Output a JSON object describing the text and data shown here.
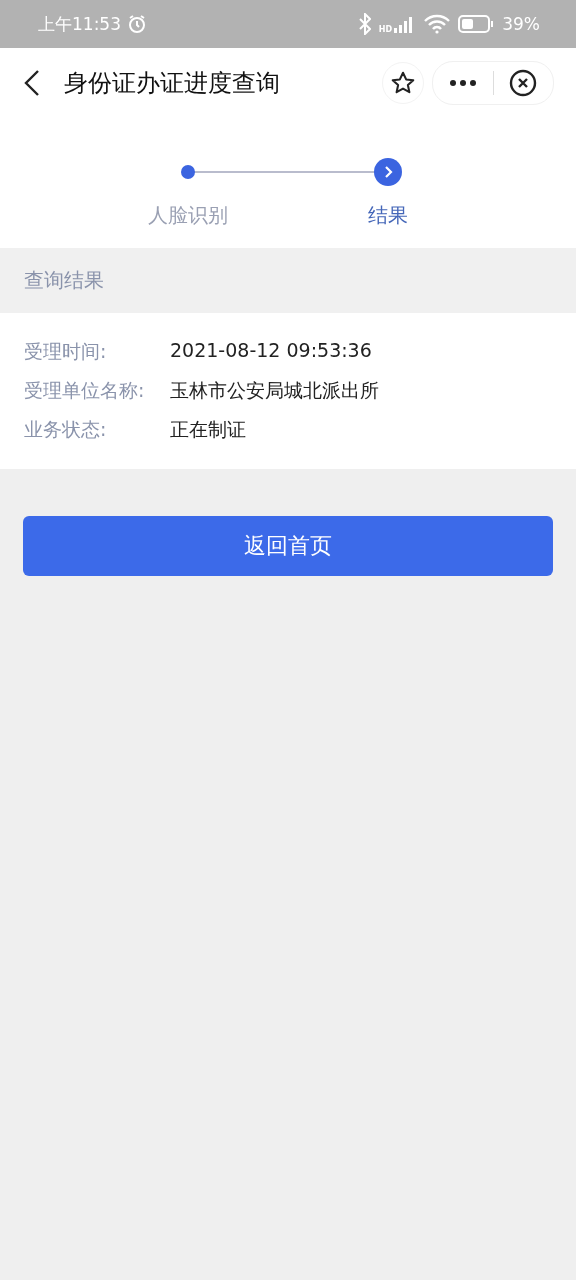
{
  "status_bar": {
    "time": "上午11:53",
    "network": "HD",
    "battery": "39%"
  },
  "nav": {
    "title": "身份证办证进度查询"
  },
  "steps": [
    {
      "label": "人脸识别",
      "selected": false
    },
    {
      "label": "结果",
      "selected": true
    }
  ],
  "section": {
    "title": "查询结果"
  },
  "fields": [
    {
      "label": "受理时间:",
      "value": "2021-08-12 09:53:36"
    },
    {
      "label": "受理单位名称:",
      "value": "玉林市公安局城北派出所"
    },
    {
      "label": "业务状态:",
      "value": "正在制证"
    }
  ],
  "button": {
    "label": "返回首页"
  }
}
